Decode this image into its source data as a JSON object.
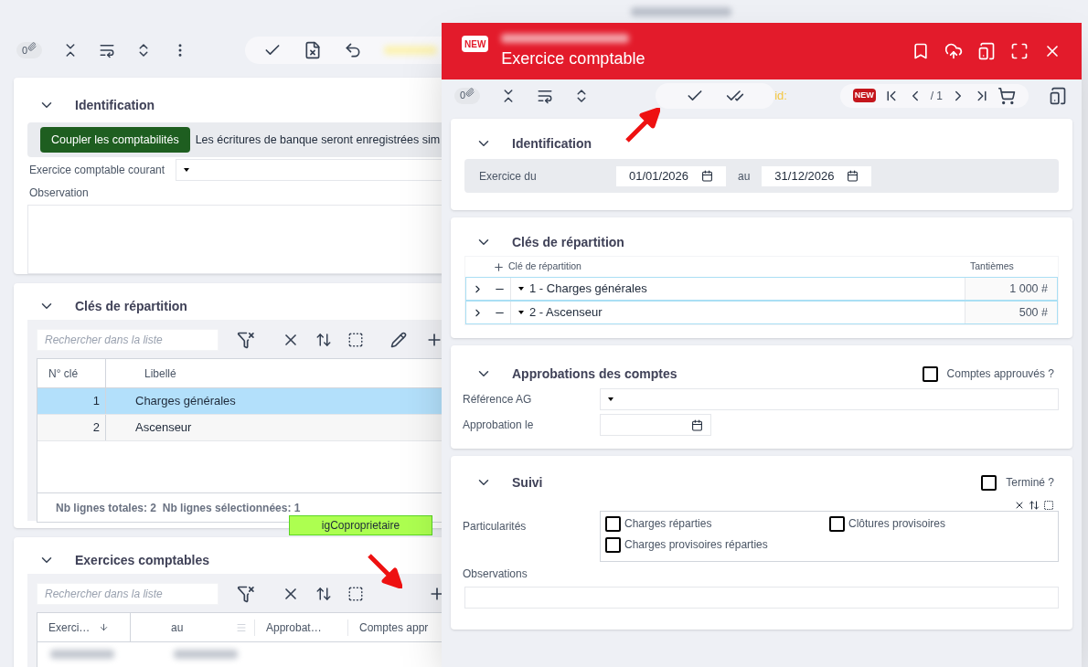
{
  "background": {
    "toolbar": {
      "attachments": "0"
    },
    "identification": {
      "title": "Identification",
      "button": "Coupler les comptabilités",
      "note": "Les écritures de banque seront enregistrées sim",
      "current_label": "Exercice comptable courant",
      "observation_label": "Observation"
    },
    "keys": {
      "title": "Clés de répartition",
      "search_placeholder": "Rechercher dans la liste",
      "columns": [
        "N° clé",
        "Libellé"
      ],
      "rows": [
        {
          "number": "1",
          "label": "Charges générales",
          "selected": true
        },
        {
          "number": "2",
          "label": "Ascenseur",
          "selected": false
        }
      ],
      "footer": "Nb lignes totales: **2**  Nb lignes sélectionnées: **1**",
      "tag": "igCoproprietaire"
    },
    "exercises": {
      "title": "Exercices comptables",
      "search_placeholder": "Rechercher dans la liste",
      "columns": [
        "Exerci…",
        "au",
        "Approbat…",
        "Comptes appr"
      ]
    }
  },
  "dialog": {
    "badge": "NEW",
    "title": "Exercice comptable",
    "attachments": "0",
    "id_label": "id:",
    "nav_badge": "NEW",
    "page": "/ 1",
    "identification": {
      "title": "Identification",
      "label": "Exercice du",
      "from": "01/01/2026",
      "to_label": "au",
      "to": "31/12/2026"
    },
    "keys": {
      "title": "Clés de répartition",
      "columns": [
        "Clé de répartition",
        "Tantièmes"
      ],
      "rows": [
        {
          "label": "1 - Charges générales",
          "value": "1 000 #"
        },
        {
          "label": "2 - Ascenseur",
          "value": "500 #"
        }
      ]
    },
    "approvals": {
      "title": "Approbations des comptes",
      "approved": {
        "label": "Comptes approuvés ?",
        "checked": false
      },
      "ref_label": "Référence AG",
      "date_label": "Approbation le"
    },
    "follow": {
      "title": "Suivi",
      "done": {
        "label": "Terminé ?",
        "checked": false
      },
      "features_label": "Particularités",
      "features": [
        {
          "label": "Charges réparties",
          "checked": false
        },
        {
          "label": "Clôtures provisoires",
          "checked": false
        },
        {
          "label": "Charges provisoires réparties",
          "checked": false
        }
      ],
      "observations_label": "Observations"
    }
  }
}
